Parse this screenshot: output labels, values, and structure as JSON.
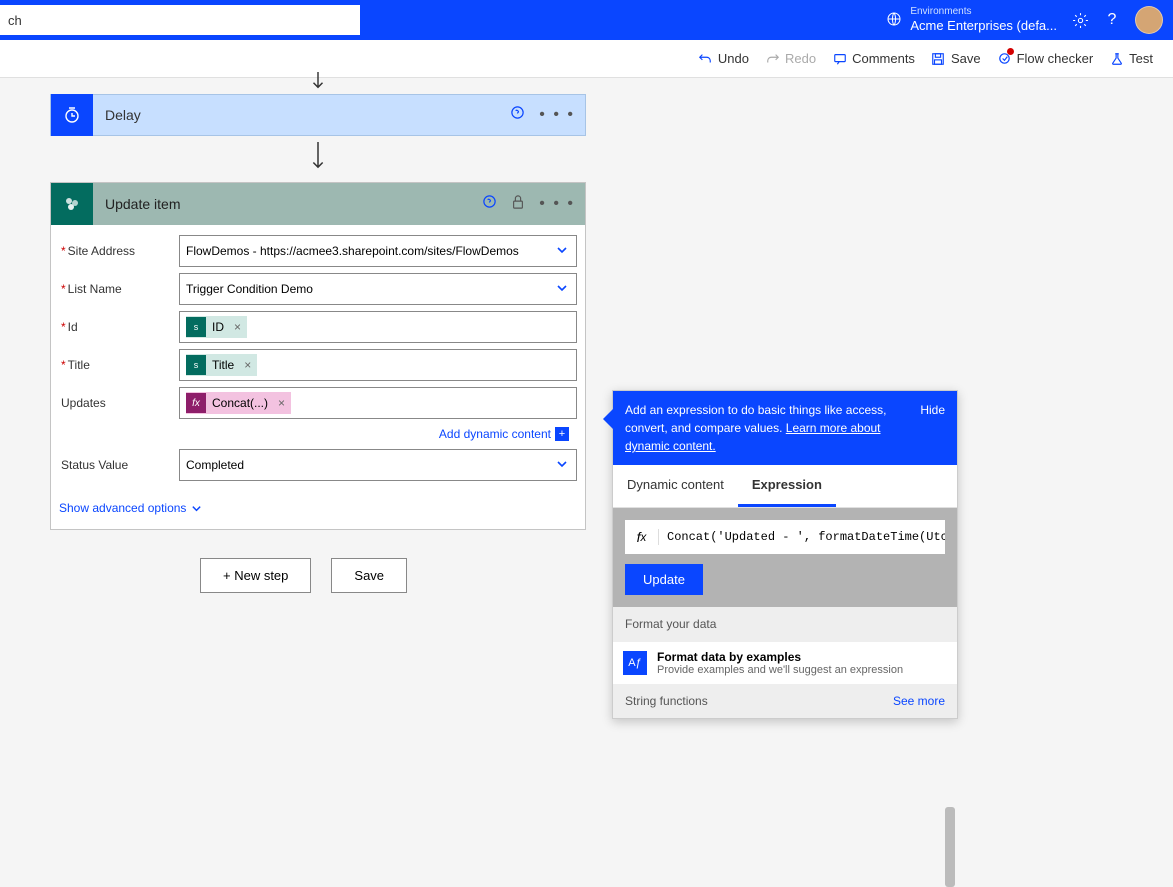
{
  "topbar": {
    "search_partial": "ch",
    "env_label": "Environments",
    "env_name": "Acme Enterprises (defa..."
  },
  "toolbar": {
    "undo": "Undo",
    "redo": "Redo",
    "comments": "Comments",
    "save": "Save",
    "flow_checker": "Flow checker",
    "test": "Test"
  },
  "delay": {
    "title": "Delay"
  },
  "update": {
    "title": "Update item",
    "fields": {
      "site_address": {
        "label": "Site Address",
        "value": "FlowDemos - https://acmee3.sharepoint.com/sites/FlowDemos"
      },
      "list_name": {
        "label": "List Name",
        "value": "Trigger Condition Demo"
      },
      "id": {
        "label": "Id",
        "token": "ID"
      },
      "title_f": {
        "label": "Title",
        "token": "Title"
      },
      "updates": {
        "label": "Updates",
        "token": "Concat(...)"
      },
      "status": {
        "label": "Status Value",
        "value": "Completed"
      }
    },
    "dyn_link": "Add dynamic content",
    "adv_link": "Show advanced options"
  },
  "actions": {
    "new_step": "+ New step",
    "save": "Save"
  },
  "expr": {
    "head_text": "Add an expression to do basic things like access, convert, and compare values. ",
    "head_link": "Learn more about dynamic content.",
    "hide": "Hide",
    "tabs": {
      "dyn": "Dynamic content",
      "expr": "Expression"
    },
    "value": "Concat('Updated - ', formatDateTime(UtcNow",
    "update_btn": "Update",
    "format_label": "Format your data",
    "format_title": "Format data by examples",
    "format_sub": "Provide examples and we'll suggest an expression",
    "string_fn": "String functions",
    "see_more": "See more"
  }
}
